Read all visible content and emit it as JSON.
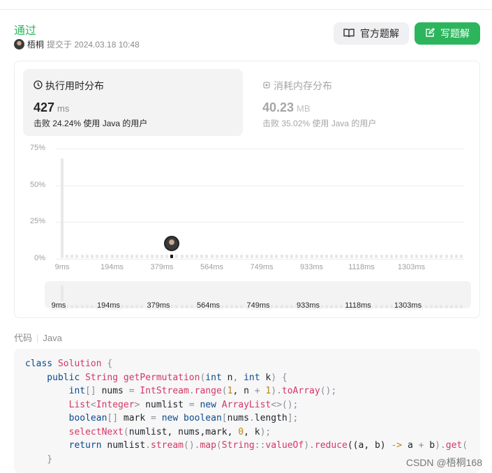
{
  "header": {
    "status": "通过",
    "user": "梧桐",
    "submitted_label": "提交于 2024.03.18 10:48",
    "official_solution_button": "官方题解",
    "write_solution_button": "写题解",
    "accent": "#2db55d"
  },
  "runtime": {
    "title": "执行用时分布",
    "value": "427",
    "unit": "ms",
    "beat": "击败 24.24% 使用 Java 的用户",
    "icon": "clock-icon"
  },
  "memory": {
    "title": "消耗内存分布",
    "value": "40.23",
    "unit": "MB",
    "beat": "击败 35.02% 使用 Java 的用户",
    "icon": "chip-icon"
  },
  "chart_data": {
    "type": "bar",
    "y_ticks": [
      "75%",
      "50%",
      "25%",
      "0%"
    ],
    "ylim": [
      0,
      75
    ],
    "x_ticks": [
      "9ms",
      "194ms",
      "379ms",
      "564ms",
      "749ms",
      "933ms",
      "1118ms",
      "1303ms"
    ],
    "bin_start_ms": 9,
    "bin_width_ms": 18.5,
    "values": [
      68,
      0,
      0,
      0,
      0,
      0,
      0,
      0,
      0,
      0,
      0,
      0,
      0,
      0,
      0,
      0,
      0,
      0,
      0,
      0,
      0,
      0,
      0,
      0,
      0,
      0,
      0,
      0,
      0,
      0,
      0,
      0,
      0,
      0,
      0,
      0,
      0,
      0,
      0,
      0,
      0,
      0,
      0,
      0,
      0,
      0,
      0,
      0,
      0,
      0,
      0,
      0,
      0,
      0,
      0,
      0,
      0,
      0,
      0,
      0,
      0,
      0,
      0,
      0,
      0,
      0,
      0,
      0,
      0,
      0,
      0,
      0,
      0,
      0,
      0,
      0,
      0,
      0,
      0,
      0,
      0
    ],
    "highlight_bin": 22,
    "grid": true
  },
  "code_section": {
    "label": "代码",
    "language": "Java",
    "lines": [
      [
        [
          "class ",
          "kw"
        ],
        [
          "Solution ",
          "ty"
        ],
        [
          "{",
          "pn"
        ]
      ],
      [
        [
          "    public ",
          "kw"
        ],
        [
          "String ",
          "ty"
        ],
        [
          "getPermutation",
          "fn"
        ],
        [
          "(",
          "pn"
        ],
        [
          "int ",
          "kw"
        ],
        [
          "n",
          ""
        ],
        [
          ", ",
          "pn"
        ],
        [
          "int ",
          "kw"
        ],
        [
          "k",
          ""
        ],
        [
          ") {",
          "pn"
        ]
      ],
      [
        [
          "        int",
          "kw"
        ],
        [
          "[] ",
          "pn"
        ],
        [
          "nums ",
          ""
        ],
        [
          "= ",
          "pn"
        ],
        [
          "IntStream",
          "ty"
        ],
        [
          ".",
          "pn"
        ],
        [
          "range",
          "fn"
        ],
        [
          "(",
          "pn"
        ],
        [
          "1",
          "nm"
        ],
        [
          ", n ",
          ""
        ],
        [
          "+ ",
          "pn"
        ],
        [
          "1",
          "nm"
        ],
        [
          ").",
          "pn"
        ],
        [
          "toArray",
          "fn"
        ],
        [
          "();",
          "pn"
        ]
      ],
      [
        [
          "        List",
          "ty"
        ],
        [
          "<",
          "pn"
        ],
        [
          "Integer",
          "ty"
        ],
        [
          "> ",
          "pn"
        ],
        [
          "numlist ",
          ""
        ],
        [
          "= ",
          "pn"
        ],
        [
          "new ",
          "kw"
        ],
        [
          "ArrayList",
          "ty"
        ],
        [
          "<>();",
          "pn"
        ]
      ],
      [
        [
          "        boolean",
          "kw"
        ],
        [
          "[] ",
          "pn"
        ],
        [
          "mark ",
          ""
        ],
        [
          "= ",
          "pn"
        ],
        [
          "new ",
          "kw"
        ],
        [
          "boolean",
          "kw"
        ],
        [
          "[",
          "pn"
        ],
        [
          "nums",
          ""
        ],
        [
          ".",
          "pn"
        ],
        [
          "length",
          ""
        ],
        [
          "];",
          "pn"
        ]
      ],
      [
        [
          "        selectNext",
          "fn"
        ],
        [
          "(",
          "pn"
        ],
        [
          "numlist, nums,mark, ",
          ""
        ],
        [
          "0",
          "nm"
        ],
        [
          ", k",
          ""
        ],
        [
          ");",
          "pn"
        ]
      ],
      [
        [
          "        return ",
          "kw"
        ],
        [
          "numlist",
          ""
        ],
        [
          ".",
          "pn"
        ],
        [
          "stream",
          "fn"
        ],
        [
          "().",
          "pn"
        ],
        [
          "map",
          "fn"
        ],
        [
          "(",
          "pn"
        ],
        [
          "String",
          "ty"
        ],
        [
          "::",
          "pn"
        ],
        [
          "valueOf",
          "fn"
        ],
        [
          ").",
          "pn"
        ],
        [
          "reduce",
          "fn"
        ],
        [
          "((a, b) ",
          ""
        ],
        [
          "-> ",
          "nm"
        ],
        [
          "a ",
          ""
        ],
        [
          "+ ",
          "pn"
        ],
        [
          "b",
          ""
        ],
        [
          ").",
          "pn"
        ],
        [
          "get",
          "fn"
        ],
        [
          "(",
          "pn"
        ]
      ],
      [
        [
          "    }",
          "pn"
        ]
      ]
    ]
  },
  "watermark": "CSDN @梧桐168"
}
